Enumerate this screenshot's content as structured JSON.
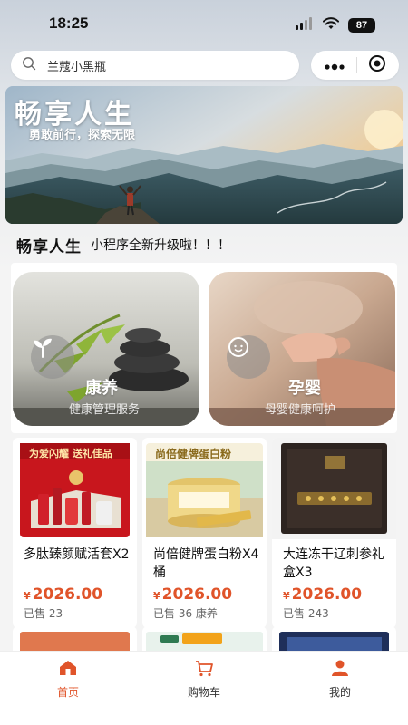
{
  "status_bar": {
    "time": "18:25",
    "battery": "87"
  },
  "search": {
    "value": "兰蔻小黑瓶"
  },
  "banner": {
    "title": "畅享人生",
    "subtitle": "勇敢前行，探索无限"
  },
  "notice": {
    "title": "畅享人生",
    "text": "小程序全新升级啦！！！"
  },
  "categories": [
    {
      "name": "康养",
      "desc": "健康管理服务",
      "icon": "sprout-icon"
    },
    {
      "name": "孕婴",
      "desc": "母婴健康呵护",
      "icon": "baby-face-icon"
    }
  ],
  "products": [
    {
      "name": "多肽臻颜赋活套X2",
      "currency": "¥",
      "price": "2026.00",
      "sold": "已售 23",
      "image_label": "为爱闪耀 送礼佳品"
    },
    {
      "name": "尚倍健牌蛋白粉X4桶",
      "currency": "¥",
      "price": "2026.00",
      "sold": "已售 36 康养",
      "image_label": "尚倍健牌蛋白粉"
    },
    {
      "name": "大连冻干辽刺参礼盒X3",
      "currency": "¥",
      "price": "2026.00",
      "sold": "已售 243",
      "image_label": ""
    }
  ],
  "tab_bar": {
    "items": [
      {
        "label": "首页",
        "icon": "home-icon",
        "active": true
      },
      {
        "label": "购物车",
        "icon": "cart-icon",
        "active": false
      },
      {
        "label": "我的",
        "icon": "profile-icon",
        "active": false
      }
    ]
  },
  "colors": {
    "accent": "#e0542a",
    "background": "#f4f4f4"
  }
}
